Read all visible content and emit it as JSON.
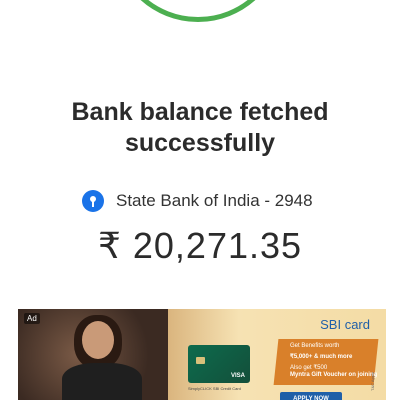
{
  "status": {
    "headline_line1": "Bank balance fetched",
    "headline_line2": "successfully",
    "accent_color": "#4caf50"
  },
  "account": {
    "bank_icon": "sbi-logo-icon",
    "bank_label": "State Bank of India - 2948",
    "balance": "₹ 20,271.35"
  },
  "ad": {
    "badge": "Ad",
    "brand_prefix": "SBI",
    "brand_suffix": "card",
    "offer_line1": "Get Benefits worth",
    "offer_line2": "₹5,000+ & much more",
    "offer_line3": "Also get ₹500",
    "offer_line4": "Myntra Gift Voucher on joining",
    "card_caption": "SimplyCLICK SBI Credit Card",
    "card_network": "VISA",
    "cta_label": "APPLY NOW",
    "tnc": "T&C Apply"
  }
}
